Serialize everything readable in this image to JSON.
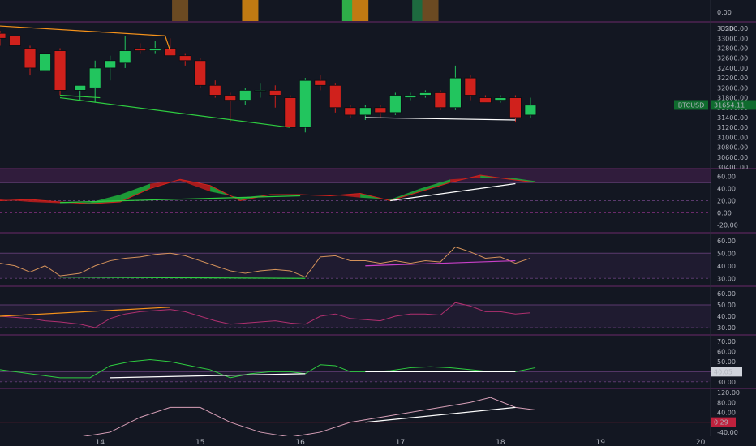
{
  "colors": {
    "background": "#131722",
    "separator": "#6b2a6b",
    "bull": "#22c55e",
    "bear": "#d0211c",
    "orange_line": "#f7931a",
    "green_line": "#2ecc40",
    "white_line": "#ffffff",
    "price_tag": "#0f6b2e",
    "value_tag": "#c0213d"
  },
  "top_strip": {
    "axis_label": "0.00",
    "blocks": [
      {
        "x": 15.5,
        "color": "#c07a12"
      },
      {
        "x": 14.8,
        "color": "#6b4a22"
      },
      {
        "x": 16.5,
        "color": "#2eae48"
      },
      {
        "x": 16.6,
        "color": "#c07a12"
      },
      {
        "x": 17.2,
        "color": "#1d6a3f"
      },
      {
        "x": 17.3,
        "color": "#6b4a22"
      }
    ]
  },
  "price_pane": {
    "currency": "USD",
    "symbol": "BTCUSD",
    "last_price": "31654.11",
    "y_ticks": [
      "33200.00",
      "33000.00",
      "32800.00",
      "32600.00",
      "32400.00",
      "32200.00",
      "32000.00",
      "31800.00",
      "31600.00",
      "31400.00",
      "31200.00",
      "31000.00",
      "30800.00",
      "30600.00",
      "30400.00"
    ]
  },
  "pane2": {
    "y_ticks": [
      "60.00",
      "40.00",
      "20.00",
      "0.00",
      "-20.00"
    ]
  },
  "pane3": {
    "y_ticks": [
      "60.00",
      "50.00",
      "40.00",
      "30.00"
    ]
  },
  "pane4": {
    "y_ticks": [
      "60.00",
      "50.00",
      "40.00",
      "30.00"
    ]
  },
  "pane5": {
    "y_ticks": [
      "70.00",
      "60.00",
      "50.00",
      "40.00",
      "30.00"
    ],
    "value_tag": "40.05"
  },
  "pane6": {
    "y_ticks": [
      "120.00",
      "80.00",
      "40.00",
      "-40.00"
    ],
    "value_tag": "0.29"
  },
  "x_axis": {
    "labels": [
      "14",
      "15",
      "16",
      "17",
      "18",
      "19",
      "20"
    ]
  },
  "chart_data": [
    {
      "type": "candlestick",
      "title": "BTCUSD",
      "ylabel": "USD",
      "ylim": [
        30400,
        33300
      ],
      "xlim": [
        13.0,
        20.1
      ],
      "x_ticks": [
        14,
        15,
        16,
        17,
        18,
        19,
        20
      ],
      "candles": [
        {
          "x": 13.0,
          "o": 33100,
          "h": 33150,
          "l": 32850,
          "c": 33000
        },
        {
          "x": 13.15,
          "o": 33050,
          "h": 33100,
          "l": 32600,
          "c": 32850
        },
        {
          "x": 13.3,
          "o": 32800,
          "h": 32850,
          "l": 32250,
          "c": 32400
        },
        {
          "x": 13.45,
          "o": 32350,
          "h": 32750,
          "l": 32300,
          "c": 32700
        },
        {
          "x": 13.6,
          "o": 32750,
          "h": 32800,
          "l": 31850,
          "c": 31950
        },
        {
          "x": 13.8,
          "o": 31950,
          "h": 32050,
          "l": 31750,
          "c": 32050
        },
        {
          "x": 13.95,
          "o": 32000,
          "h": 32550,
          "l": 31700,
          "c": 32400
        },
        {
          "x": 14.1,
          "o": 32400,
          "h": 32650,
          "l": 32150,
          "c": 32550
        },
        {
          "x": 14.25,
          "o": 32500,
          "h": 33050,
          "l": 32400,
          "c": 32750
        },
        {
          "x": 14.4,
          "o": 32800,
          "h": 32900,
          "l": 32700,
          "c": 32750
        },
        {
          "x": 14.55,
          "o": 32750,
          "h": 32950,
          "l": 32700,
          "c": 32800
        },
        {
          "x": 14.7,
          "o": 32800,
          "h": 33000,
          "l": 32650,
          "c": 32650
        },
        {
          "x": 14.85,
          "o": 32650,
          "h": 32700,
          "l": 32450,
          "c": 32550
        },
        {
          "x": 15.0,
          "o": 32550,
          "h": 32600,
          "l": 32000,
          "c": 32050
        },
        {
          "x": 15.15,
          "o": 32050,
          "h": 32150,
          "l": 31800,
          "c": 31850
        },
        {
          "x": 15.3,
          "o": 31850,
          "h": 31900,
          "l": 31300,
          "c": 31750
        },
        {
          "x": 15.45,
          "o": 31750,
          "h": 32000,
          "l": 31650,
          "c": 31950
        },
        {
          "x": 15.6,
          "o": 31950,
          "h": 32100,
          "l": 31800,
          "c": 31950
        },
        {
          "x": 15.75,
          "o": 31950,
          "h": 32050,
          "l": 31600,
          "c": 31850
        },
        {
          "x": 15.9,
          "o": 31800,
          "h": 31850,
          "l": 31200,
          "c": 31200
        },
        {
          "x": 16.05,
          "o": 31200,
          "h": 32200,
          "l": 31100,
          "c": 32150
        },
        {
          "x": 16.2,
          "o": 32150,
          "h": 32250,
          "l": 31950,
          "c": 32050
        },
        {
          "x": 16.35,
          "o": 32050,
          "h": 32100,
          "l": 31500,
          "c": 31600
        },
        {
          "x": 16.5,
          "o": 31600,
          "h": 31650,
          "l": 31400,
          "c": 31450
        },
        {
          "x": 16.65,
          "o": 31450,
          "h": 31650,
          "l": 31350,
          "c": 31600
        },
        {
          "x": 16.8,
          "o": 31600,
          "h": 31650,
          "l": 31400,
          "c": 31500
        },
        {
          "x": 16.95,
          "o": 31500,
          "h": 31900,
          "l": 31450,
          "c": 31850
        },
        {
          "x": 17.1,
          "o": 31800,
          "h": 31900,
          "l": 31750,
          "c": 31850
        },
        {
          "x": 17.25,
          "o": 31850,
          "h": 31950,
          "l": 31800,
          "c": 31900
        },
        {
          "x": 17.4,
          "o": 31900,
          "h": 31950,
          "l": 31550,
          "c": 31600
        },
        {
          "x": 17.55,
          "o": 31600,
          "h": 32450,
          "l": 31550,
          "c": 32200
        },
        {
          "x": 17.7,
          "o": 32200,
          "h": 32250,
          "l": 31750,
          "c": 31850
        },
        {
          "x": 17.85,
          "o": 31800,
          "h": 31850,
          "l": 31700,
          "c": 31700
        },
        {
          "x": 18.0,
          "o": 31750,
          "h": 31850,
          "l": 31700,
          "c": 31800
        },
        {
          "x": 18.15,
          "o": 31800,
          "h": 31850,
          "l": 31300,
          "c": 31400
        },
        {
          "x": 18.3,
          "o": 31450,
          "h": 31800,
          "l": 31400,
          "c": 31650
        }
      ],
      "lines": [
        {
          "color": "orange",
          "points": [
            [
              13.0,
              33250
            ],
            [
              14.65,
              33050
            ],
            [
              14.7,
              32750
            ]
          ]
        },
        {
          "color": "green",
          "points": [
            [
              13.6,
              31850
            ],
            [
              14.0,
              31800
            ]
          ]
        },
        {
          "color": "green",
          "points": [
            [
              13.6,
              31800
            ],
            [
              15.9,
              31200
            ]
          ]
        },
        {
          "color": "white",
          "points": [
            [
              16.65,
              31400
            ],
            [
              18.15,
              31350
            ]
          ]
        }
      ]
    },
    {
      "type": "area",
      "ylim": [
        -30,
        70
      ],
      "x": [
        13.0,
        13.3,
        13.6,
        13.9,
        14.2,
        14.5,
        14.8,
        15.1,
        15.4,
        15.7,
        16.0,
        16.3,
        16.6,
        16.9,
        17.2,
        17.5,
        17.8,
        18.1,
        18.35
      ],
      "series": [
        {
          "values": [
            20,
            22,
            18,
            15,
            18,
            40,
            55,
            45,
            20,
            30,
            30,
            28,
            32,
            20,
            35,
            50,
            62,
            55,
            50
          ]
        },
        {
          "values": [
            22,
            18,
            16,
            17,
            30,
            48,
            53,
            35,
            25,
            30,
            30,
            30,
            25,
            22,
            40,
            55,
            58,
            58,
            52
          ]
        }
      ],
      "lines": [
        {
          "color": "green",
          "points": [
            [
              13.6,
              17
            ],
            [
              16.0,
              28
            ]
          ]
        },
        {
          "color": "white",
          "points": [
            [
              16.9,
              20
            ],
            [
              18.15,
              48
            ]
          ]
        }
      ]
    },
    {
      "type": "line",
      "ylim": [
        25,
        65
      ],
      "x": [
        13.0,
        13.15,
        13.3,
        13.45,
        13.6,
        13.8,
        13.95,
        14.1,
        14.25,
        14.4,
        14.55,
        14.7,
        14.85,
        15.0,
        15.15,
        15.3,
        15.45,
        15.6,
        15.75,
        15.9,
        16.05,
        16.2,
        16.35,
        16.5,
        16.65,
        16.8,
        16.95,
        17.1,
        17.25,
        17.4,
        17.55,
        17.7,
        17.85,
        18.0,
        18.15,
        18.3
      ],
      "series": [
        {
          "values": [
            42,
            40,
            35,
            40,
            32,
            34,
            40,
            44,
            46,
            47,
            49,
            50,
            48,
            44,
            40,
            36,
            34,
            36,
            37,
            36,
            31,
            47,
            48,
            44,
            44,
            42,
            44,
            42,
            44,
            43,
            55,
            51,
            46,
            47,
            42,
            46
          ]
        }
      ],
      "lines": [
        {
          "color": "green",
          "points": [
            [
              13.6,
              31
            ],
            [
              16.05,
              30
            ]
          ]
        },
        {
          "color": "magenta",
          "points": [
            [
              16.65,
              40
            ],
            [
              18.15,
              44
            ]
          ]
        }
      ]
    },
    {
      "type": "line",
      "ylim": [
        25,
        65
      ],
      "x": [
        13.0,
        13.15,
        13.3,
        13.45,
        13.6,
        13.8,
        13.95,
        14.1,
        14.25,
        14.4,
        14.55,
        14.7,
        14.85,
        15.0,
        15.15,
        15.3,
        15.45,
        15.6,
        15.75,
        15.9,
        16.05,
        16.2,
        16.35,
        16.5,
        16.65,
        16.8,
        16.95,
        17.1,
        17.25,
        17.4,
        17.55,
        17.7,
        17.85,
        18.0,
        18.15,
        18.3
      ],
      "series": [
        {
          "values": [
            40,
            39,
            38,
            36,
            35,
            33,
            30,
            38,
            42,
            44,
            45,
            46,
            44,
            40,
            36,
            33,
            34,
            35,
            36,
            34,
            33,
            40,
            42,
            38,
            37,
            36,
            40,
            42,
            42,
            41,
            52,
            49,
            44,
            44,
            42,
            43
          ]
        }
      ],
      "lines": [
        {
          "color": "orange",
          "points": [
            [
              13.0,
              40
            ],
            [
              14.7,
              48
            ]
          ]
        }
      ]
    },
    {
      "type": "line",
      "ylim": [
        25,
        75
      ],
      "x": [
        13.0,
        13.3,
        13.6,
        13.9,
        14.1,
        14.3,
        14.5,
        14.7,
        14.9,
        15.1,
        15.3,
        15.5,
        15.7,
        15.9,
        16.05,
        16.2,
        16.35,
        16.5,
        16.7,
        16.9,
        17.1,
        17.3,
        17.5,
        17.7,
        17.9,
        18.15,
        18.35
      ],
      "series": [
        {
          "values": [
            42,
            38,
            34,
            34,
            46,
            50,
            52,
            50,
            46,
            42,
            34,
            38,
            40,
            40,
            38,
            47,
            46,
            40,
            40,
            41,
            44,
            45,
            44,
            42,
            40,
            40,
            44
          ]
        }
      ],
      "lines": [
        {
          "color": "white",
          "points": [
            [
              14.1,
              34
            ],
            [
              16.05,
              38
            ]
          ]
        },
        {
          "color": "white",
          "points": [
            [
              16.65,
              40
            ],
            [
              18.15,
              40
            ]
          ]
        }
      ]
    },
    {
      "type": "line",
      "ylim": [
        -50,
        130
      ],
      "x": [
        13.0,
        13.4,
        13.8,
        14.1,
        14.4,
        14.7,
        15.0,
        15.3,
        15.6,
        15.9,
        16.2,
        16.5,
        16.8,
        17.1,
        17.4,
        17.7,
        17.9,
        18.15,
        18.35
      ],
      "series": [
        {
          "values": [
            -60,
            -60,
            -60,
            -40,
            20,
            60,
            60,
            0,
            -40,
            -60,
            -40,
            0,
            20,
            40,
            60,
            80,
            100,
            60,
            50
          ]
        }
      ],
      "lines": [
        {
          "color": "white",
          "points": [
            [
              16.65,
              0
            ],
            [
              18.15,
              60
            ]
          ]
        }
      ]
    }
  ]
}
